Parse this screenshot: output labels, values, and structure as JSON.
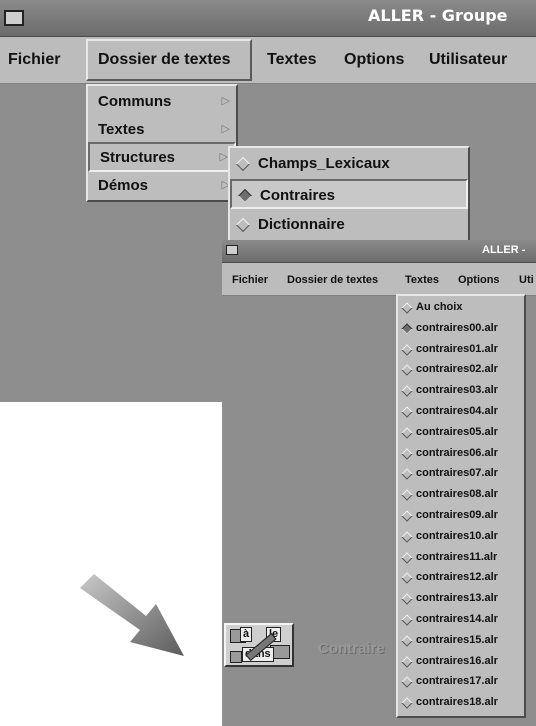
{
  "window_main": {
    "title": "ALLER - Groupe",
    "menu": [
      "Fichier",
      "Dossier de textes",
      "Textes",
      "Options",
      "Utilisateur"
    ]
  },
  "dossier_menu": {
    "items": [
      "Communs",
      "Textes",
      "Structures",
      "Démos"
    ],
    "selected": "Structures"
  },
  "structures_submenu": {
    "items": [
      "Champs_Lexicaux",
      "Contraires",
      "Dictionnaire"
    ],
    "selected": "Contraires"
  },
  "window_small": {
    "title": "ALLER -",
    "menu": [
      "Fichier",
      "Dossier de textes",
      "Textes",
      "Options",
      "Uti"
    ]
  },
  "textes_menu": {
    "items": [
      "Au choix",
      "contraires00.alr",
      "contraires01.alr",
      "contraires02.alr",
      "contraires03.alr",
      "contraires04.alr",
      "contraires05.alr",
      "contraires06.alr",
      "contraires07.alr",
      "contraires08.alr",
      "contraires09.alr",
      "contraires10.alr",
      "contraires11.alr",
      "contraires12.alr",
      "contraires13.alr",
      "contraires14.alr",
      "contraires15.alr",
      "contraires16.alr",
      "contraires17.alr",
      "contraires18.alr"
    ],
    "selected": "contraires00.alr"
  },
  "toolbar_widget": {
    "words": [
      "à",
      "le",
      "dans"
    ],
    "label": "Contraire"
  },
  "colors": {
    "window_bg": "#8e8e8e",
    "menu_bg": "#bcbcbc",
    "title_text": "#ffffff"
  }
}
